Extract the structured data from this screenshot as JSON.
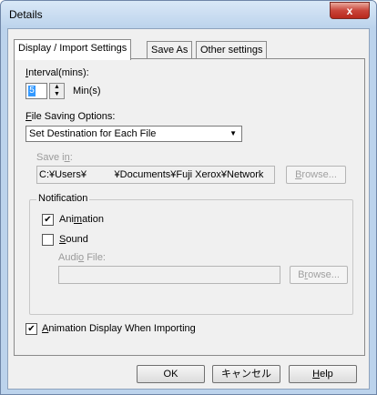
{
  "window": {
    "title": "Details",
    "close_glyph": "x"
  },
  "tabs": [
    {
      "label": "Display / Import Settings"
    },
    {
      "label": "Save As"
    },
    {
      "label": "Other settings"
    }
  ],
  "interval": {
    "label_pre": "",
    "label_hot": "I",
    "label_post": "nterval(mins):",
    "value": "5",
    "unit": "Min(s)"
  },
  "file_saving": {
    "label_hot": "F",
    "label_post": "ile Saving Options:",
    "selected": "Set Destination for Each File",
    "save_in_pre": "Save i",
    "save_in_hot": "n",
    "save_in_post": ":",
    "path": "C:¥Users¥          ¥Documents¥Fuji Xerox¥Network",
    "browse_pre": "",
    "browse_hot": "B",
    "browse_post": "rowse..."
  },
  "notification": {
    "legend": "Notification",
    "animation_pre": "Ani",
    "animation_hot": "m",
    "animation_post": "ation",
    "animation_checked": true,
    "sound_hot": "S",
    "sound_post": "ound",
    "sound_checked": false,
    "audio_pre": "Audi",
    "audio_hot": "o",
    "audio_post": " File:",
    "audio_value": "",
    "browse_pre": "B",
    "browse_hot": "r",
    "browse_post": "owse..."
  },
  "animation_import": {
    "label_hot": "A",
    "label_post": "nimation Display When Importing",
    "checked": true
  },
  "footer": {
    "ok": "OK",
    "cancel": "キャンセル",
    "help_hot": "H",
    "help_post": "elp"
  },
  "check_glyph": "✔"
}
